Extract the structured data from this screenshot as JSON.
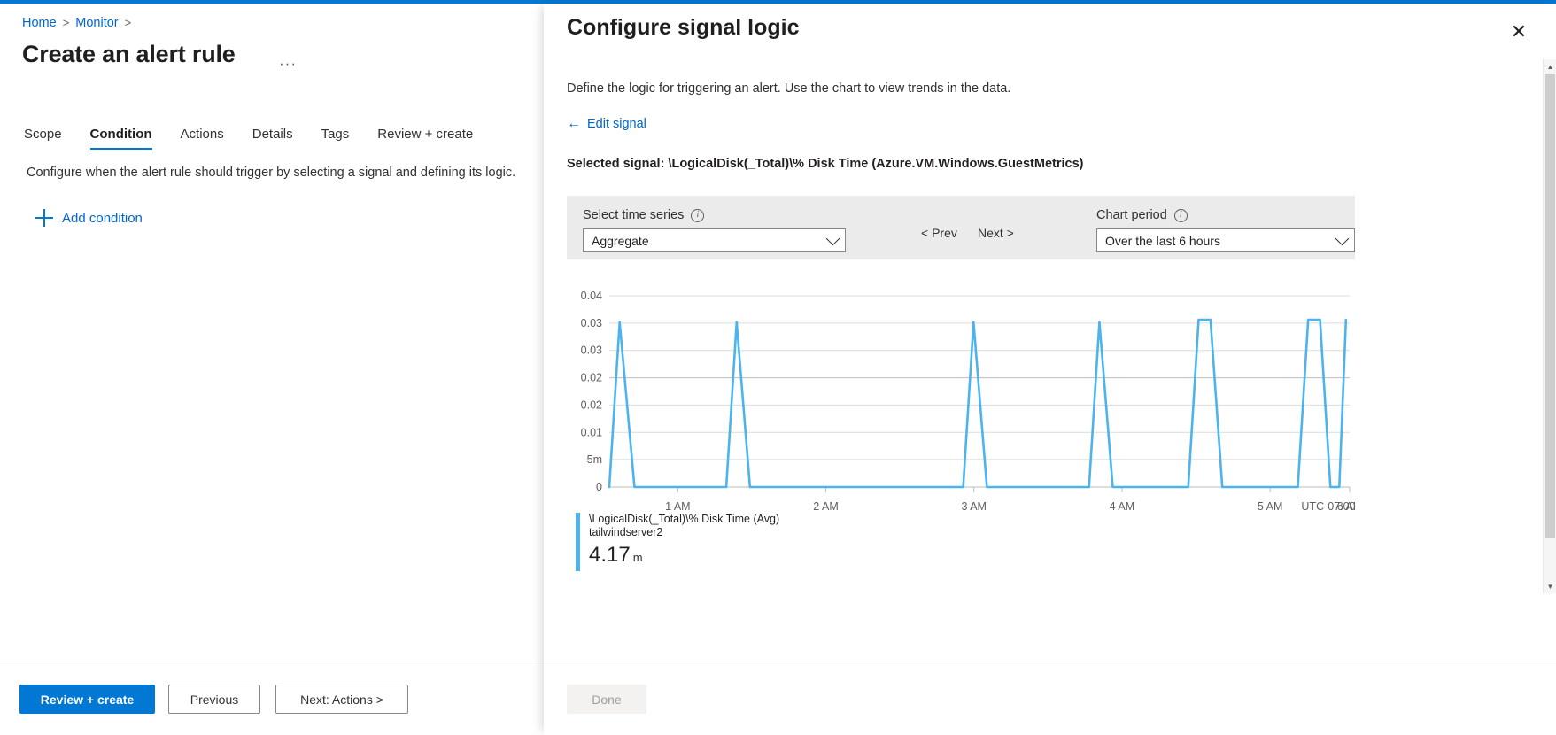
{
  "theme": {
    "accent": "#0078d4",
    "link": "#0066cc",
    "chart_line": "#4cb3ec",
    "strip_bg": "#ebebeb"
  },
  "left": {
    "breadcrumb": {
      "home": "Home",
      "monitor": "Monitor",
      "separator": ">"
    },
    "title": "Create an alert rule",
    "more_label": "···",
    "tabs": [
      {
        "label": "Scope",
        "active": false
      },
      {
        "label": "Condition",
        "active": true
      },
      {
        "label": "Actions",
        "active": false
      },
      {
        "label": "Details",
        "active": false
      },
      {
        "label": "Tags",
        "active": false
      },
      {
        "label": "Review + create",
        "active": false
      }
    ],
    "description": "Configure when the alert rule should trigger by selecting a signal and defining its logic.",
    "add_condition_label": "Add condition",
    "footer": {
      "review_create": "Review + create",
      "previous": "Previous",
      "next": "Next: Actions >"
    }
  },
  "blade": {
    "title": "Configure signal logic",
    "close_label": "✕",
    "description": "Define the logic for triggering an alert. Use the chart to view trends in the data.",
    "edit_signal": {
      "arrow": "←",
      "label": "Edit signal"
    },
    "selected_signal": "Selected signal: \\LogicalDisk(_Total)\\% Disk Time (Azure.VM.Windows.GuestMetrics)",
    "controls": {
      "time_series_label": "Select time series",
      "time_series_value": "Aggregate",
      "prev_label": "< Prev",
      "next_label": "Next >",
      "chart_period_label": "Chart period",
      "chart_period_value": "Over the last 6 hours",
      "info_glyph": "i"
    },
    "legend": {
      "line1": "\\LogicalDisk(_Total)\\% Disk Time (Avg)",
      "line2": "tailwindserver2",
      "value": "4.17",
      "unit": "m"
    },
    "footer": {
      "done": "Done"
    }
  },
  "chart_data": {
    "type": "line",
    "title": "",
    "xlabel": "",
    "ylabel": "",
    "timezone_label": "UTC-07:00",
    "grid": true,
    "legend_position": "below",
    "ytick_labels": [
      "0.04",
      "0.03",
      "0.03",
      "0.02",
      "0.02",
      "0.01",
      "5m",
      "0"
    ],
    "ytick_values": [
      0.04,
      0.035,
      0.03,
      0.025,
      0.02,
      0.01,
      0.005,
      0
    ],
    "ylim": [
      0,
      0.04
    ],
    "xtick_labels": [
      "1 AM",
      "2 AM",
      "3 AM",
      "4 AM",
      "5 AM",
      "6 AM"
    ],
    "xtick_positions": [
      0.0925,
      0.2925,
      0.4925,
      0.6925,
      0.8925,
      1.0
    ],
    "series": [
      {
        "name": "\\LogicalDisk(_Total)\\% Disk Time (Avg) tailwindserver2",
        "color": "#4cb3ec",
        "points": [
          {
            "x": 0.0,
            "y": 0.0
          },
          {
            "x": 0.014,
            "y": 0.0345
          },
          {
            "x": 0.034,
            "y": 0.0
          },
          {
            "x": 0.158,
            "y": 0.0
          },
          {
            "x": 0.172,
            "y": 0.0345
          },
          {
            "x": 0.19,
            "y": 0.0
          },
          {
            "x": 0.478,
            "y": 0.0
          },
          {
            "x": 0.492,
            "y": 0.0345
          },
          {
            "x": 0.51,
            "y": 0.0
          },
          {
            "x": 0.648,
            "y": 0.0
          },
          {
            "x": 0.662,
            "y": 0.0345
          },
          {
            "x": 0.68,
            "y": 0.0
          },
          {
            "x": 0.782,
            "y": 0.0
          },
          {
            "x": 0.796,
            "y": 0.035
          },
          {
            "x": 0.812,
            "y": 0.035
          },
          {
            "x": 0.828,
            "y": 0.0
          },
          {
            "x": 0.93,
            "y": 0.0
          },
          {
            "x": 0.944,
            "y": 0.035
          },
          {
            "x": 0.96,
            "y": 0.035
          },
          {
            "x": 0.974,
            "y": 0.0
          },
          {
            "x": 0.986,
            "y": 0.0
          },
          {
            "x": 0.995,
            "y": 0.035
          }
        ]
      }
    ]
  }
}
